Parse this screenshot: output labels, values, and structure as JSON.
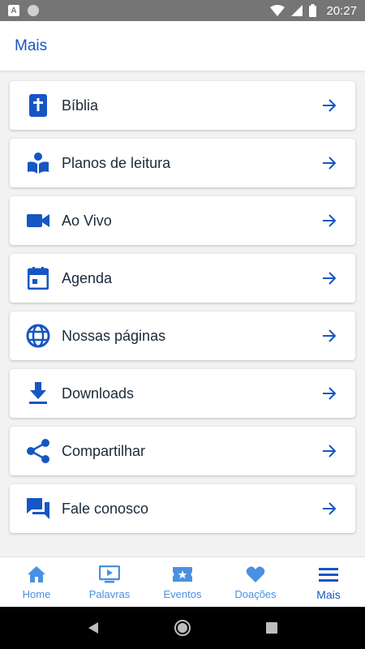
{
  "status_bar": {
    "notification_badge": "A",
    "time": "20:27"
  },
  "header": {
    "title": "Mais"
  },
  "colors": {
    "accent": "#1656c4",
    "nav_inactive": "#4a90e2",
    "text": "#1b2a3a"
  },
  "menu": {
    "items": [
      {
        "label": "Bíblia",
        "icon": "bible-icon"
      },
      {
        "label": "Planos de leitura",
        "icon": "reading-plan-icon"
      },
      {
        "label": "Ao Vivo",
        "icon": "video-camera-icon"
      },
      {
        "label": "Agenda",
        "icon": "calendar-icon"
      },
      {
        "label": "Nossas páginas",
        "icon": "globe-icon"
      },
      {
        "label": "Downloads",
        "icon": "download-icon"
      },
      {
        "label": "Compartilhar",
        "icon": "share-icon"
      },
      {
        "label": "Fale conosco",
        "icon": "chat-icon"
      }
    ]
  },
  "bottom_nav": {
    "items": [
      {
        "label": "Home",
        "icon": "home-icon"
      },
      {
        "label": "Palavras",
        "icon": "tv-play-icon"
      },
      {
        "label": "Eventos",
        "icon": "ticket-star-icon"
      },
      {
        "label": "Doações",
        "icon": "heart-icon"
      },
      {
        "label": "Mais",
        "icon": "menu-icon"
      }
    ],
    "active": "Mais"
  }
}
